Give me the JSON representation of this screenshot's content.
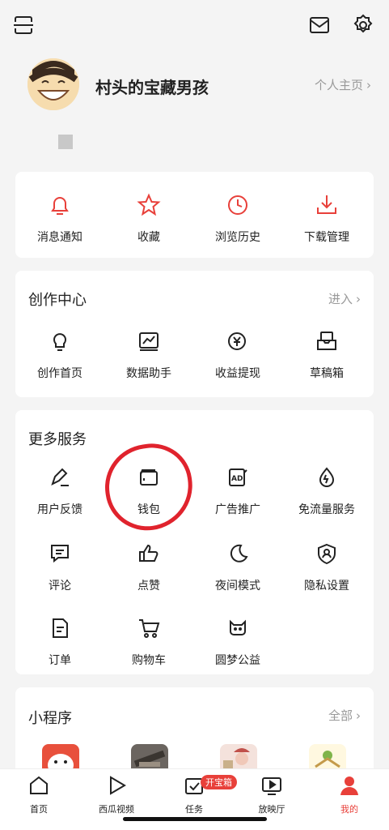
{
  "topbar": {
    "scan_icon": "scan-icon",
    "mail_icon": "mail-icon",
    "settings_icon": "gear-icon"
  },
  "profile": {
    "username": "村头的宝藏男孩",
    "homepage_link": "个人主页"
  },
  "quick_actions": [
    {
      "label": "消息通知",
      "icon": "bell-icon"
    },
    {
      "label": "收藏",
      "icon": "star-icon"
    },
    {
      "label": "浏览历史",
      "icon": "clock-icon"
    },
    {
      "label": "下载管理",
      "icon": "download-icon"
    }
  ],
  "creation_center": {
    "title": "创作中心",
    "more": "进入",
    "items": [
      {
        "label": "创作首页",
        "icon": "lightbulb-icon"
      },
      {
        "label": "数据助手",
        "icon": "chart-icon"
      },
      {
        "label": "收益提现",
        "icon": "yen-icon"
      },
      {
        "label": "草稿箱",
        "icon": "draft-box-icon"
      }
    ]
  },
  "more_services": {
    "title": "更多服务",
    "items": [
      {
        "label": "用户反馈",
        "icon": "pen-icon"
      },
      {
        "label": "钱包",
        "icon": "wallet-icon"
      },
      {
        "label": "广告推广",
        "icon": "ad-icon"
      },
      {
        "label": "免流量服务",
        "icon": "drop-icon"
      },
      {
        "label": "评论",
        "icon": "comment-icon"
      },
      {
        "label": "点赞",
        "icon": "thumbs-up-icon"
      },
      {
        "label": "夜间模式",
        "icon": "moon-icon"
      },
      {
        "label": "隐私设置",
        "icon": "shield-user-icon"
      },
      {
        "label": "订单",
        "icon": "order-icon"
      },
      {
        "label": "购物车",
        "icon": "cart-icon"
      },
      {
        "label": "圆梦公益",
        "icon": "charity-icon"
      }
    ]
  },
  "mini_programs": {
    "title": "小程序",
    "more": "全部"
  },
  "tabbar": {
    "badge": "开宝箱",
    "tabs": [
      {
        "label": "首页",
        "icon": "home-icon"
      },
      {
        "label": "西瓜视频",
        "icon": "play-icon"
      },
      {
        "label": "任务",
        "icon": "task-icon"
      },
      {
        "label": "放映厅",
        "icon": "screen-icon"
      },
      {
        "label": "我的",
        "icon": "user-icon"
      }
    ]
  },
  "colors": {
    "accent": "#e8403a",
    "annotation": "#e0232d"
  }
}
